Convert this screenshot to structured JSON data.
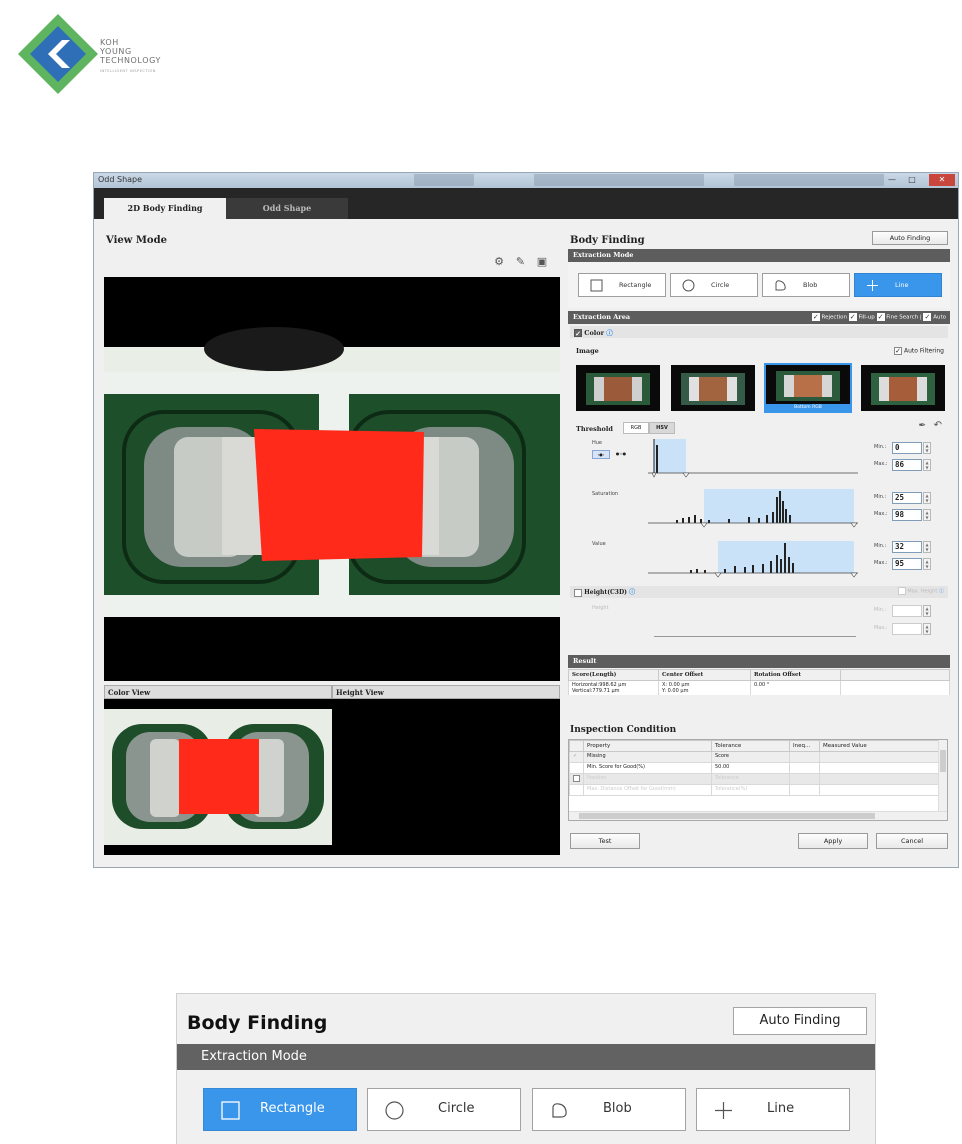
{
  "logo": {
    "lines": [
      "KOH",
      "YOUNG",
      "TECHNOLOGY"
    ],
    "tagline": "INTELLIGENT INSPECTION"
  },
  "window": {
    "title": "Odd Shape",
    "tabs": [
      {
        "label": "2D Body Finding",
        "active": true
      },
      {
        "label": "Odd Shape",
        "active": false
      }
    ]
  },
  "view": {
    "title": "View Mode",
    "color_view": "Color View",
    "height_view": "Height View"
  },
  "body_finding": {
    "title": "Body Finding",
    "auto_finding": "Auto Finding",
    "extraction_mode": {
      "header": "Extraction Mode",
      "modes": [
        {
          "label": "Rectangle",
          "icon": "square-icon",
          "active": false
        },
        {
          "label": "Circle",
          "icon": "circle-icon",
          "active": false
        },
        {
          "label": "Blob",
          "icon": "blob-icon",
          "active": false
        },
        {
          "label": "Line",
          "icon": "plus-icon",
          "active": true
        }
      ]
    },
    "extraction_area": {
      "header": "Extraction Area",
      "options": [
        "Rejection",
        "Fill-up",
        "Fine Search",
        "Auto"
      ],
      "color_label": "Color",
      "image_label": "Image",
      "auto_filtering": "Auto Filtering",
      "selected_thumb_caption": "Bottom RGB",
      "threshold_label": "Threshold",
      "threshold_tabs": [
        "RGB",
        "HSV"
      ],
      "channels": [
        {
          "name": "Hue",
          "min": "0",
          "max": "86"
        },
        {
          "name": "Saturation",
          "min": "25",
          "max": "98"
        },
        {
          "name": "Value",
          "min": "32",
          "max": "95"
        }
      ],
      "min_label": "Min.:",
      "max_label": "Max.:",
      "height_label": "Height(C3D)",
      "height_sub": "Height",
      "max_height": "Max. Height"
    },
    "result": {
      "header": "Result",
      "columns": [
        "Score(Length)",
        "Center Offset",
        "Rotation Offset"
      ],
      "row1": [
        "Horizontal:998.62 µm",
        "X: 0.00 µm",
        "0.00 °"
      ],
      "row2": [
        "Vertical:779.71 µm",
        "Y: 0.00 µm",
        ""
      ]
    },
    "inspection": {
      "title": "Inspection Condition",
      "columns": [
        "Property",
        "Tolerance",
        "Ineq...",
        "Measured Value"
      ],
      "rows": [
        [
          "Missing",
          "Score",
          "",
          ""
        ],
        [
          "Min. Score for Good(%)",
          "50.00",
          "",
          ""
        ],
        [
          "Position",
          "Tolerance",
          "",
          ""
        ],
        [
          "Max. Distance Offset for Good(mm)",
          "Tolerance(%)",
          "",
          ""
        ]
      ]
    },
    "buttons": {
      "test": "Test",
      "apply": "Apply",
      "cancel": "Cancel"
    }
  },
  "zoom": {
    "title": "Body Finding",
    "auto_finding": "Auto Finding",
    "header": "Extraction Mode",
    "modes": [
      {
        "label": "Rectangle",
        "icon": "square-icon",
        "active": true
      },
      {
        "label": "Circle",
        "icon": "circle-icon",
        "active": false
      },
      {
        "label": "Blob",
        "icon": "blob-icon",
        "active": false
      },
      {
        "label": "Line",
        "icon": "plus-icon",
        "active": false
      }
    ]
  },
  "colors": {
    "accent": "#3996ea",
    "highlight_red": "#ff2a1a",
    "header_gray": "#5d5d5d"
  }
}
